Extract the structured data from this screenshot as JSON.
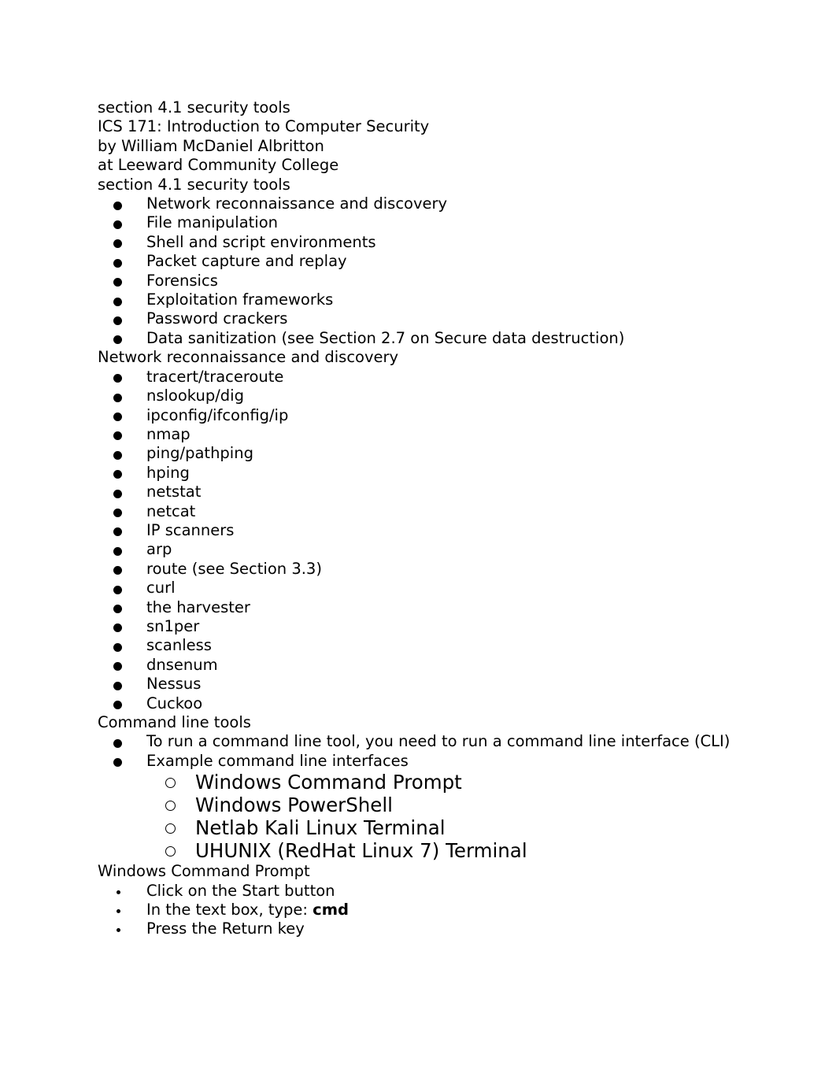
{
  "document": {
    "header_lines": [
      "section 4.1 security tools",
      "ICS 171: Introduction to Computer Security",
      "by William McDaniel Albritton",
      "at Leeward Community College"
    ],
    "sections": [
      {
        "heading": "section 4.1 security tools",
        "items": [
          "Network reconnaissance and discovery",
          "File manipulation",
          "Shell and script environments",
          "Packet capture and replay",
          "Forensics",
          "Exploitation frameworks",
          "Password crackers",
          "Data sanitization (see Section 2.7 on Secure data destruction)"
        ]
      },
      {
        "heading": "Network reconnaissance and discovery",
        "items": [
          "tracert/traceroute",
          "nslookup/dig",
          "ipconfig/ifconfig/ip",
          "nmap",
          "ping/pathping",
          "hping",
          "netstat",
          "netcat",
          "IP scanners",
          "arp",
          "route (see Section 3.3)",
          "curl",
          "the harvester",
          "sn1per",
          "scanless",
          "dnsenum",
          "Nessus",
          "Cuckoo"
        ]
      },
      {
        "heading": "Command line tools",
        "items": [
          "To run a command line tool, you need to run a command line interface (CLI)",
          "Example command line interfaces"
        ],
        "subitems": [
          "Windows Command Prompt",
          "Windows PowerShell",
          "Netlab Kali Linux Terminal",
          "UHUNIX (RedHat Linux 7) Terminal"
        ]
      },
      {
        "heading": "Windows Command Prompt",
        "steps": [
          {
            "prefix": "Click on the Start button",
            "bold": "",
            "suffix": ""
          },
          {
            "prefix": "In the text box, type: ",
            "bold": "cmd",
            "suffix": ""
          },
          {
            "prefix": "Press the Return key",
            "bold": "",
            "suffix": ""
          }
        ]
      }
    ]
  },
  "colors": {
    "text": "#000000",
    "background": "#ffffff"
  }
}
